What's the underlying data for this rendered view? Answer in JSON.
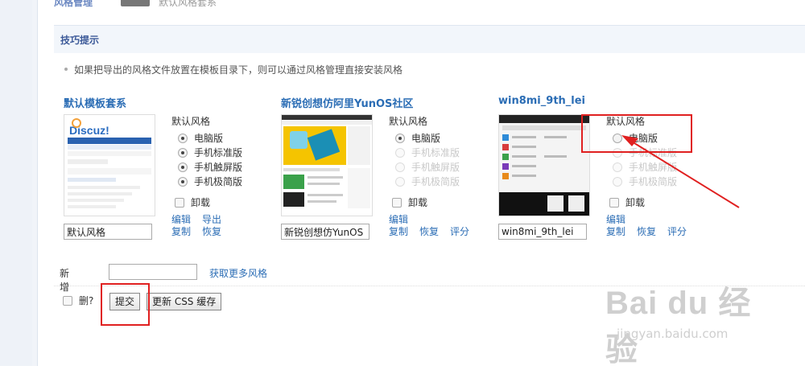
{
  "top": {
    "title": "风格管理",
    "subtitle": "默认风格套系"
  },
  "tips": {
    "title": "技巧提示",
    "text": "如果把导出的风格文件放置在模板目录下，则可以通过风格管理直接安装风格"
  },
  "themes": [
    {
      "name": "默认模板套系",
      "input_value": "默认风格",
      "style_label": "默认风格",
      "options": [
        "电脑版",
        "手机标准版",
        "手机触屏版",
        "手机极简版"
      ],
      "selected": [
        true,
        true,
        true,
        true
      ],
      "disabled": [
        false,
        false,
        false,
        false
      ],
      "uninstall": "卸载",
      "actions": [
        "编辑",
        "导出",
        "复制",
        "恢复"
      ],
      "thumb_logo": "Discuz!"
    },
    {
      "name": "新锐创想仿阿里YunOS社区",
      "input_value": "新锐创想仿YunOS",
      "style_label": "默认风格",
      "options": [
        "电脑版",
        "手机标准版",
        "手机触屏版",
        "手机极简版"
      ],
      "selected": [
        true,
        false,
        false,
        false
      ],
      "disabled": [
        false,
        true,
        true,
        true
      ],
      "uninstall": "卸载",
      "actions": [
        "编辑",
        "复制",
        "恢复",
        "评分"
      ]
    },
    {
      "name": "win8mi_9th_lei",
      "input_value": "win8mi_9th_lei",
      "style_label": "默认风格",
      "options": [
        "电脑版",
        "手机标准版",
        "手机触屏版",
        "手机极简版"
      ],
      "selected": [
        false,
        false,
        false,
        false
      ],
      "disabled": [
        false,
        true,
        true,
        true
      ],
      "uninstall": "卸载",
      "actions": [
        "编辑",
        "复制",
        "恢复",
        "评分"
      ]
    }
  ],
  "new_row": {
    "label": "新增",
    "input_value": "",
    "more_link": "获取更多风格"
  },
  "delete_label": "删?",
  "submit_label": "提交",
  "refresh_css_label": "更新 CSS 缓存",
  "watermark": {
    "brand": "Bai du 经验",
    "url": "jingyan.baidu.com"
  },
  "colors": {
    "link": "#2b6db5",
    "highlight": "#e02020",
    "tip_bg": "#f2f6fb"
  }
}
